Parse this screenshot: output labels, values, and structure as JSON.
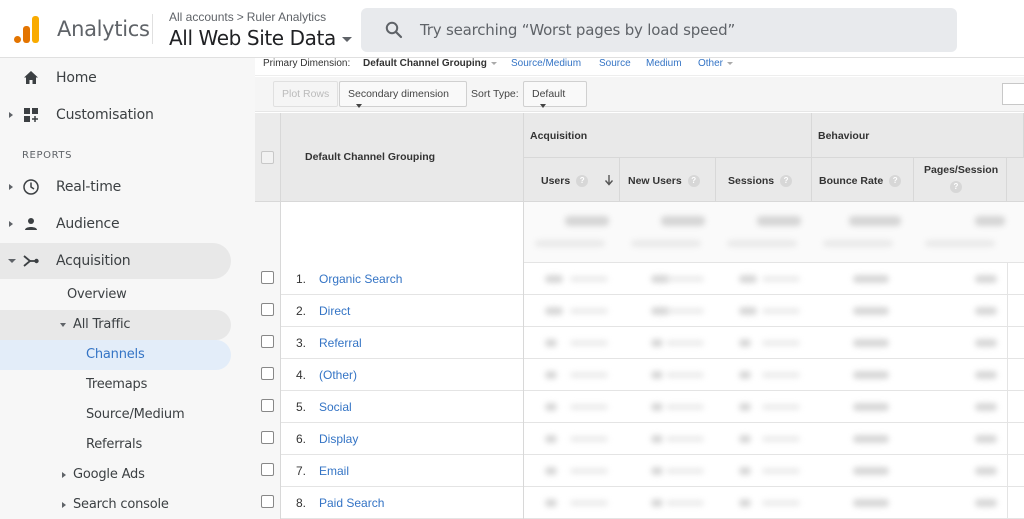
{
  "header": {
    "app_name": "Analytics",
    "breadcrumb": {
      "account": "All accounts",
      "separator": ">",
      "property": "Ruler Analytics"
    },
    "view_name": "All Web Site Data",
    "search_placeholder": "Try searching “Worst pages by load speed”"
  },
  "sidebar": {
    "items": [
      {
        "label": "Home",
        "icon": "home-icon"
      },
      {
        "label": "Customisation",
        "icon": "dashboard-add-icon"
      }
    ],
    "section_label": "REPORTS",
    "reports": [
      {
        "label": "Real-time",
        "icon": "clock-icon"
      },
      {
        "label": "Audience",
        "icon": "person-icon"
      },
      {
        "label": "Acquisition",
        "icon": "acquisition-icon",
        "expanded": true
      }
    ],
    "acquisition_children": [
      {
        "label": "Overview"
      },
      {
        "label": "All Traffic",
        "expanded": true
      },
      {
        "label": "Channels",
        "selected": true
      },
      {
        "label": "Treemaps"
      },
      {
        "label": "Source/Medium"
      },
      {
        "label": "Referrals"
      },
      {
        "label": "Google Ads"
      },
      {
        "label": "Search console"
      }
    ]
  },
  "report": {
    "primary_dimension_label": "Primary Dimension:",
    "primary_dimension_current": "Default Channel Grouping",
    "primary_dimension_options": [
      "Source/Medium",
      "Source",
      "Medium",
      "Other"
    ],
    "toolbar": {
      "plot_rows": "Plot Rows",
      "secondary_dimension": "Secondary dimension",
      "sort_type_label": "Sort Type:",
      "sort_type_value": "Default"
    },
    "table": {
      "dimension_header": "Default Channel Grouping",
      "groups": [
        {
          "label": "Acquisition",
          "columns": [
            "Users",
            "New Users",
            "Sessions"
          ]
        },
        {
          "label": "Behaviour",
          "columns": [
            "Bounce Rate",
            "Pages/Session"
          ]
        }
      ],
      "sorted_column": "Users",
      "sort_direction": "descending",
      "help_glyph": "?",
      "values_note": "Metric values are blurred in the screenshot",
      "rows": [
        {
          "index": "1.",
          "channel": "Organic Search"
        },
        {
          "index": "2.",
          "channel": "Direct"
        },
        {
          "index": "3.",
          "channel": "Referral"
        },
        {
          "index": "4.",
          "channel": "(Other)"
        },
        {
          "index": "5.",
          "channel": "Social"
        },
        {
          "index": "6.",
          "channel": "Display"
        },
        {
          "index": "7.",
          "channel": "Email"
        },
        {
          "index": "8.",
          "channel": "Paid Search"
        }
      ]
    }
  },
  "colors": {
    "link": "#3474c5",
    "selected_bg": "#e3edf9",
    "logo_orange": "#e37400",
    "logo_yellow": "#f9ab00"
  }
}
